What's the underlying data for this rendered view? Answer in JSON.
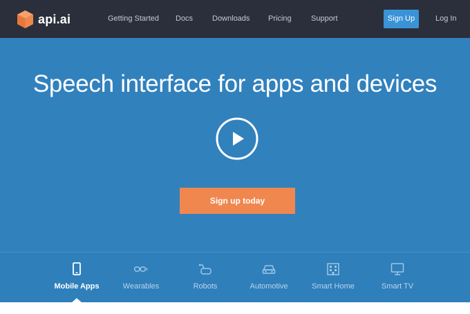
{
  "brand": {
    "name": "api.ai",
    "logo_icon": "cube-icon",
    "logo_color": "#f0874f"
  },
  "nav": {
    "links": [
      "Getting Started",
      "Docs",
      "Downloads",
      "Pricing",
      "Support"
    ],
    "signup_label": "Sign Up",
    "login_label": "Log In"
  },
  "hero": {
    "title": "Speech interface for apps and devices",
    "play_icon": "play-icon",
    "cta_label": "Sign up today"
  },
  "tabs": [
    {
      "label": "Mobile Apps",
      "icon": "mobile-phone-icon",
      "active": true
    },
    {
      "label": "Wearables",
      "icon": "smart-glasses-icon",
      "active": false
    },
    {
      "label": "Robots",
      "icon": "robot-icon",
      "active": false
    },
    {
      "label": "Automotive",
      "icon": "car-icon",
      "active": false
    },
    {
      "label": "Smart Home",
      "icon": "building-icon",
      "active": false
    },
    {
      "label": "Smart TV",
      "icon": "monitor-icon",
      "active": false
    }
  ],
  "colors": {
    "navbar": "#2b2f3b",
    "hero": "#3181bd",
    "accent": "#3a93d6",
    "cta": "#f0874f"
  }
}
